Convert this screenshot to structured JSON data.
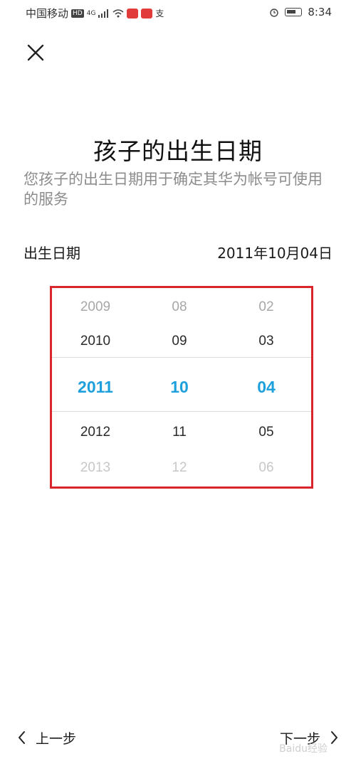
{
  "status_bar": {
    "carrier": "中国移动",
    "network": "4G",
    "time": "8:34"
  },
  "page": {
    "title": "孩子的出生日期",
    "subtitle": "您孩子的出生日期用于确定其华为帐号可使用的服务"
  },
  "birth_date": {
    "label": "出生日期",
    "value": "2011年10月04日"
  },
  "picker": {
    "years": [
      "2009",
      "2010",
      "2011",
      "2012",
      "2013"
    ],
    "months": [
      "08",
      "09",
      "10",
      "11",
      "12"
    ],
    "days": [
      "02",
      "03",
      "04",
      "05",
      "06"
    ],
    "selected": {
      "year": "2011",
      "month": "10",
      "day": "04"
    },
    "highlight_color": "#1ea0dc",
    "frame_color": "#d9262c"
  },
  "navigation": {
    "prev_label": "上一步",
    "next_label": "下一步"
  },
  "watermark": "Baidu经验"
}
